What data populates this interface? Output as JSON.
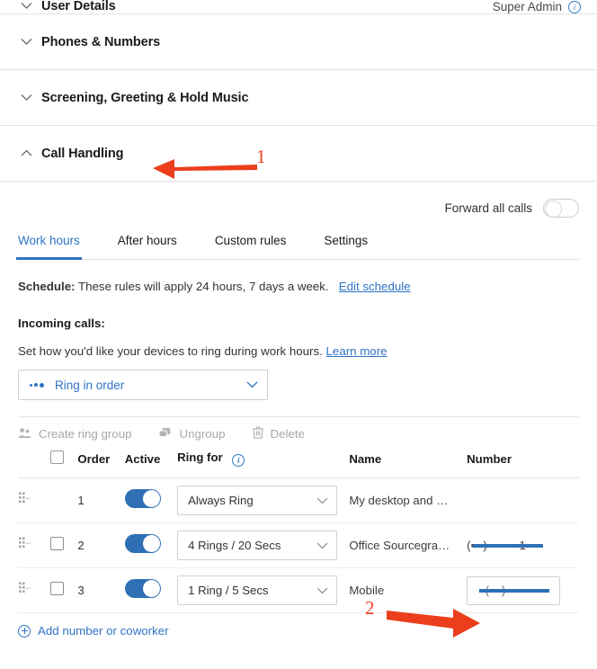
{
  "sections": [
    {
      "id": "user-details",
      "title": "User Details",
      "expanded": false,
      "chevron": "chevron-down-icon",
      "right_label": "Super Admin",
      "right_icon": "info-icon"
    },
    {
      "id": "phones-numbers",
      "title": "Phones & Numbers",
      "expanded": false,
      "chevron": "chevron-down-icon"
    },
    {
      "id": "screening-greeting",
      "title": "Screening, Greeting & Hold Music",
      "expanded": false,
      "chevron": "chevron-down-icon"
    },
    {
      "id": "call-handling",
      "title": "Call Handling",
      "expanded": true,
      "chevron": "chevron-up-icon"
    }
  ],
  "call_handling": {
    "forward_all_calls": {
      "label": "Forward all calls",
      "state": "off"
    },
    "tabs": [
      {
        "label": "Work hours",
        "active": true
      },
      {
        "label": "After hours",
        "active": false
      },
      {
        "label": "Custom rules",
        "active": false
      },
      {
        "label": "Settings",
        "active": false
      }
    ],
    "schedule": {
      "prefix": "Schedule:",
      "text": "These rules will apply 24 hours, 7 days a week.",
      "link": "Edit schedule"
    },
    "incoming": {
      "heading": "Incoming calls:",
      "description": "Set how you'd like your devices to ring during work hours.",
      "link": "Learn more",
      "ring_mode": "Ring in order",
      "ring_mode_icon": "ring-order-dots-icon",
      "ring_mode_chevron": "chevron-down-icon"
    },
    "toolbar": [
      {
        "label": "Create ring group",
        "icon": "ring-group-icon",
        "disabled": true
      },
      {
        "label": "Ungroup",
        "icon": "ungroup-icon",
        "disabled": true
      },
      {
        "label": "Delete",
        "icon": "trash-icon",
        "disabled": true
      }
    ],
    "table": {
      "headers": {
        "select_all": "",
        "order": "Order",
        "active": "Active",
        "ring_for": "Ring for",
        "ring_for_icon": "info-icon",
        "name": "Name",
        "number": "Number"
      },
      "rows": [
        {
          "handle": "drag-handle-icon",
          "has_checkbox": false,
          "checked": false,
          "order": "1",
          "active": true,
          "ring_for": "Always Ring",
          "name": "My desktop and …",
          "number": "",
          "number_redacted": false,
          "number_in_box": false
        },
        {
          "handle": "drag-handle-icon",
          "has_checkbox": true,
          "checked": false,
          "order": "2",
          "active": true,
          "ring_for": "4 Rings / 20 Secs",
          "name": "Office Sourcegra…",
          "number": "(•••) •••-•••1",
          "number_redacted": true,
          "number_in_box": false
        },
        {
          "handle": "drag-handle-icon",
          "has_checkbox": true,
          "checked": false,
          "order": "3",
          "active": true,
          "ring_for": "1 Ring / 5 Secs",
          "name": "Mobile",
          "number": "(•••) •••-••••",
          "number_redacted": true,
          "number_in_box": true
        }
      ]
    },
    "add_row": {
      "label": "Add number or coworker",
      "icon": "plus-circle-icon"
    }
  },
  "annotations": [
    {
      "label": "1",
      "target": "call-handling-section",
      "direction": "left",
      "color": "#ec3e1c"
    },
    {
      "label": "2",
      "target": "row-3-number-field",
      "direction": "right",
      "color": "#ec3e1c"
    }
  ],
  "colors": {
    "accent_blue": "#2f73c4",
    "toggle_on": "#2f6fb4",
    "annotation_red": "#ec3e1c",
    "border": "#e3e3e3",
    "text": "#333333"
  }
}
